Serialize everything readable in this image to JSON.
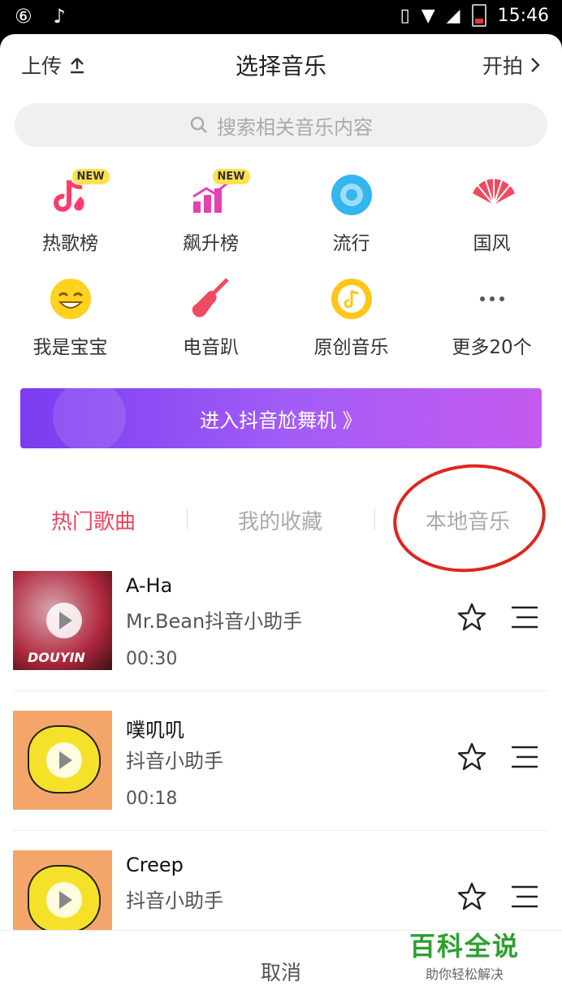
{
  "status_bar": {
    "time": "15:46",
    "left_icons": [
      "netease-cloud-music-icon",
      "tiktok-icon"
    ],
    "right_icons": [
      "vibrate-icon",
      "wifi-icon",
      "signal-icon",
      "battery-icon"
    ]
  },
  "header": {
    "upload_label": "上传",
    "title": "选择音乐",
    "shoot_label": "开拍"
  },
  "search": {
    "placeholder": "搜索相关音乐内容"
  },
  "categories": [
    {
      "label": "热歌榜",
      "badge": "NEW",
      "icon": "hot-chart-icon"
    },
    {
      "label": "飙升榜",
      "badge": "NEW",
      "icon": "rising-chart-icon"
    },
    {
      "label": "流行",
      "badge": "",
      "icon": "disc-icon"
    },
    {
      "label": "国风",
      "badge": "",
      "icon": "fan-icon"
    },
    {
      "label": "我是宝宝",
      "badge": "",
      "icon": "smiley-icon"
    },
    {
      "label": "电音趴",
      "badge": "",
      "icon": "guitar-icon"
    },
    {
      "label": "原创音乐",
      "badge": "",
      "icon": "music-note-icon"
    },
    {
      "label": "更多20个",
      "badge": "",
      "icon": "more-dots-icon"
    }
  ],
  "banner": {
    "label": "进入抖音尬舞机 》"
  },
  "tabs": [
    {
      "label": "热门歌曲",
      "active": true
    },
    {
      "label": "我的收藏",
      "active": false
    },
    {
      "label": "本地音乐",
      "active": false
    }
  ],
  "songs": [
    {
      "title": "A-Ha",
      "artist": "Mr.Bean抖音小助手",
      "duration": "00:30",
      "cover_text": "DOUYIN"
    },
    {
      "title": "噗叽叽",
      "artist": "抖音小助手",
      "duration": "00:18",
      "cover_text": ""
    },
    {
      "title": "Creep",
      "artist": "抖音小助手",
      "duration": "",
      "cover_text": ""
    }
  ],
  "bottom": {
    "cancel_label": "取消"
  },
  "watermark": {
    "title": "百科全说",
    "subtitle": "助你轻松解决"
  },
  "colors": {
    "accent": "#e8455f",
    "banner_start": "#7a3cf0",
    "banner_end": "#c55af0",
    "annotation_circle": "#e0261c",
    "watermark_green": "#2e9f2e"
  }
}
